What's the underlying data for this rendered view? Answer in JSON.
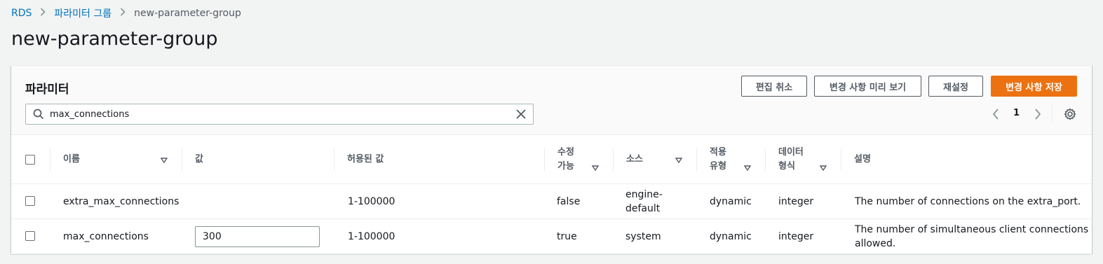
{
  "breadcrumb": {
    "root": "RDS",
    "parent": "파라미터 그룹",
    "current": "new-parameter-group"
  },
  "page_title": "new-parameter-group",
  "panel": {
    "title": "파라미터",
    "buttons": {
      "cancel": "편집 취소",
      "preview": "변경 사항 미리 보기",
      "reset": "재설정",
      "save": "변경 사항 저장"
    },
    "search": {
      "value": "max_connections",
      "placeholder": "파라미터 필터링"
    },
    "pagination": {
      "current_page": "1"
    }
  },
  "table": {
    "headers": {
      "name": "이름",
      "value": "값",
      "allowed": "허용된 값",
      "modifiable_1": "수정",
      "modifiable_2": "가능",
      "source": "소스",
      "apply_1": "적용",
      "apply_2": "유형",
      "datatype_1": "데이터",
      "datatype_2": "형식",
      "description": "설명"
    },
    "rows": [
      {
        "name": "extra_max_connections",
        "value": "",
        "allowed": "1-100000",
        "modifiable": "false",
        "source_1": "engine-",
        "source_2": "default",
        "apply_type": "dynamic",
        "data_type": "integer",
        "description_1": "The number of connections on the extra_port.",
        "description_2": ""
      },
      {
        "name": "max_connections",
        "value": "300",
        "allowed": "1-100000",
        "modifiable": "true",
        "source_1": "system",
        "source_2": "",
        "apply_type": "dynamic",
        "data_type": "integer",
        "description_1": "The number of simultaneous client connections",
        "description_2": "allowed."
      }
    ]
  },
  "colors": {
    "accent": "#ec7211",
    "link": "#0073bb",
    "background": "#f2f3f3"
  }
}
